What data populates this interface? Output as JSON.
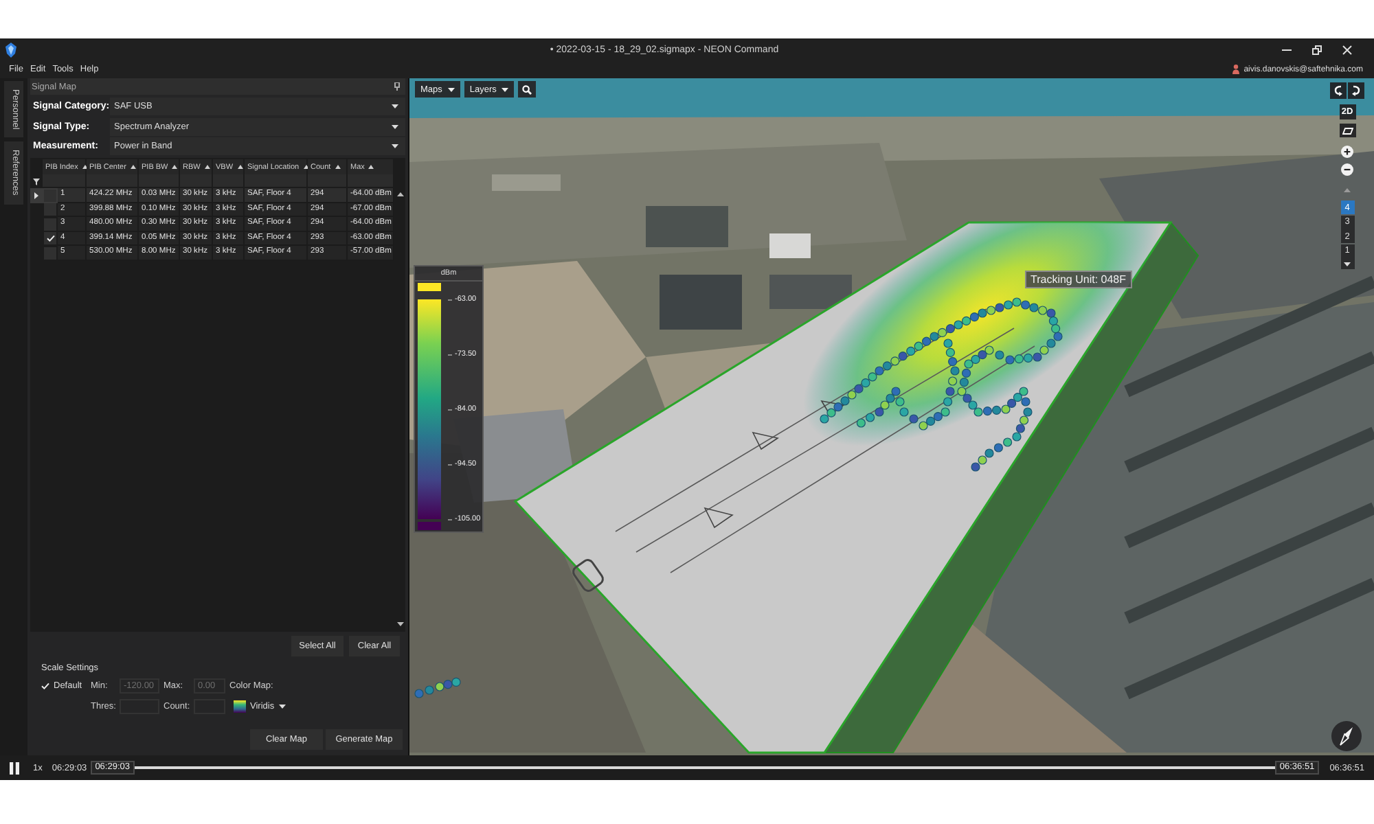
{
  "window": {
    "title": "• 2022-03-15 - 18_29_02.sigmapx - NEON Command"
  },
  "menu": [
    "File",
    "Edit",
    "Tools",
    "Help"
  ],
  "account": {
    "email": "aivis.danovskis@saftehnika.com"
  },
  "side_tabs": [
    {
      "label": "Personnel",
      "selected": false
    },
    {
      "label": "References",
      "selected": false
    }
  ],
  "signal_map": {
    "title": "Signal Map",
    "fields": [
      {
        "label": "Signal Category:",
        "value": "SAF USB"
      },
      {
        "label": "Signal Type:",
        "value": "Spectrum Analyzer"
      },
      {
        "label": "Measurement:",
        "value": "Power in Band"
      }
    ],
    "table": {
      "columns": [
        "PIB Index",
        "PIB Center",
        "PIB BW",
        "RBW",
        "VBW",
        "Signal Location",
        "Count",
        "Max"
      ],
      "rows": [
        {
          "current": true,
          "checked": false,
          "cells": [
            "1",
            "424.22 MHz",
            "0.03 MHz",
            "30 kHz",
            "3 kHz",
            "SAF, Floor 4",
            "294",
            "-64.00 dBm"
          ]
        },
        {
          "current": false,
          "checked": false,
          "cells": [
            "2",
            "399.88 MHz",
            "0.10 MHz",
            "30 kHz",
            "3 kHz",
            "SAF, Floor 4",
            "294",
            "-67.00 dBm"
          ]
        },
        {
          "current": false,
          "checked": false,
          "cells": [
            "3",
            "480.00 MHz",
            "0.30 MHz",
            "30 kHz",
            "3 kHz",
            "SAF, Floor 4",
            "294",
            "-64.00 dBm"
          ]
        },
        {
          "current": false,
          "checked": true,
          "cells": [
            "4",
            "399.14 MHz",
            "0.05 MHz",
            "30 kHz",
            "3 kHz",
            "SAF, Floor 4",
            "293",
            "-63.00 dBm"
          ]
        },
        {
          "current": false,
          "checked": false,
          "cells": [
            "5",
            "530.00 MHz",
            "8.00 MHz",
            "30 kHz",
            "3 kHz",
            "SAF, Floor 4",
            "293",
            "-57.00 dBm"
          ]
        }
      ]
    },
    "table_buttons": [
      "Select All",
      "Clear All"
    ],
    "scale_settings": {
      "title": "Scale Settings",
      "default": {
        "label": "Default",
        "checked": true
      },
      "min": {
        "label": "Min:",
        "value": "-120.00",
        "disabled": true
      },
      "max": {
        "label": "Max:",
        "value": "0.00",
        "disabled": true
      },
      "color_map": {
        "label": "Color Map:",
        "value": "Viridis"
      },
      "thres": {
        "label": "Thres:"
      },
      "count": {
        "label": "Count:"
      }
    },
    "map_buttons": [
      "Clear Map",
      "Generate Map"
    ]
  },
  "map": {
    "toolbar": [
      "Maps",
      "Layers"
    ],
    "view_button": "2D",
    "floors": [
      {
        "label": "4",
        "selected": true
      },
      {
        "label": "3",
        "selected": false
      },
      {
        "label": "2",
        "selected": false
      },
      {
        "label": "1",
        "selected": false
      }
    ],
    "legend": {
      "unit": "dBm",
      "labels": [
        "-63.00",
        "-73.50",
        "-84.00",
        "-94.50",
        "-105.00"
      ]
    },
    "tracking_label": "Tracking Unit: 048F"
  },
  "timeline": {
    "speed": "1x",
    "start_time": "06:29:03",
    "range_start": "06:29:03",
    "range_end": "06:36:51",
    "end_time": "06:36:51",
    "level": 1
  }
}
